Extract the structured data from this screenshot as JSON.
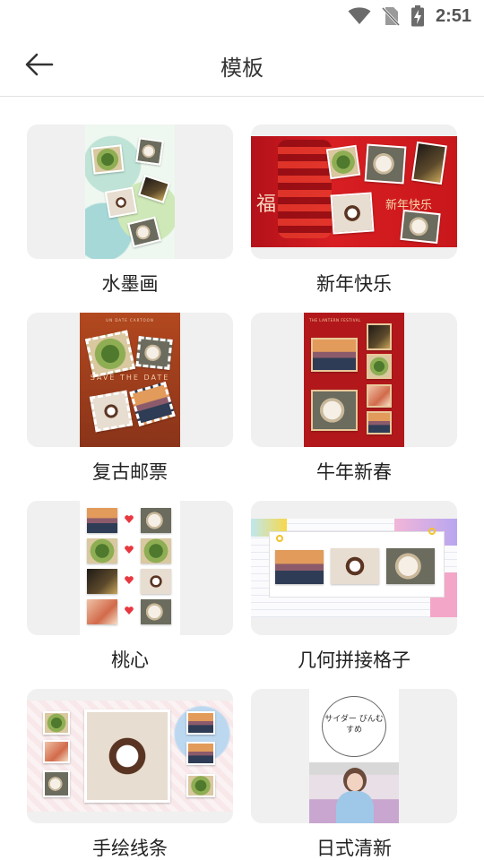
{
  "status_bar": {
    "time": "2:51",
    "icons": [
      "wifi-icon",
      "no-sim-icon",
      "battery-charging-icon"
    ]
  },
  "app_bar": {
    "title": "模板",
    "back_icon": "arrow-left-icon"
  },
  "templates": [
    {
      "label": "水墨画"
    },
    {
      "label": "新年快乐"
    },
    {
      "label": "复古邮票"
    },
    {
      "label": "牛年新春"
    },
    {
      "label": "桃心"
    },
    {
      "label": "几何拼接格子"
    },
    {
      "label": "手绘线条"
    },
    {
      "label": "日式清新"
    }
  ],
  "colors": {
    "card_bg": "#f0f0f0",
    "divider": "#e2e2e2",
    "new_year_red": "#c8171b"
  },
  "preview_text": {
    "new_year_text": "新年快乐",
    "fu_char": "福",
    "stamp_text": "SAVE THE DATE",
    "stamp_header": "UN DATE CARTOON",
    "ox_header": "THE LANTERN FESTIVAL",
    "japanese_text": "サイダー びんむすめ"
  }
}
